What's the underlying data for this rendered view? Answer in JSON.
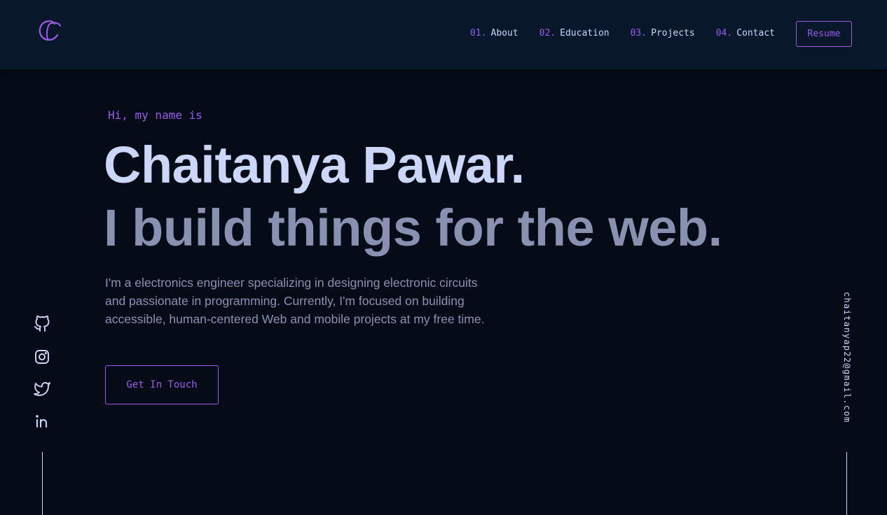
{
  "nav": {
    "items": [
      {
        "num": "01.",
        "label": "About"
      },
      {
        "num": "02.",
        "label": "Education"
      },
      {
        "num": "03.",
        "label": "Projects"
      },
      {
        "num": "04.",
        "label": "Contact"
      }
    ],
    "resume_label": "Resume"
  },
  "hero": {
    "intro": "Hi, my name is",
    "name": "Chaitanya Pawar.",
    "tagline": "I build things for the web.",
    "bio": "I'm a electronics engineer specializing in designing electronic circuits and passionate in programming. Currently, I'm focused on building accessible, human-centered Web and mobile projects at my free time.",
    "cta_label": "Get In Touch"
  },
  "email": "chaitanyap22@gmail.com",
  "social_icons": [
    "github-icon",
    "instagram-icon",
    "twitter-icon",
    "linkedin-icon"
  ],
  "colors": {
    "background": "#050c18",
    "header": "#08182a",
    "accent": "#9a5ce8",
    "heading": "#ccd6f6",
    "muted": "#8892b0"
  }
}
